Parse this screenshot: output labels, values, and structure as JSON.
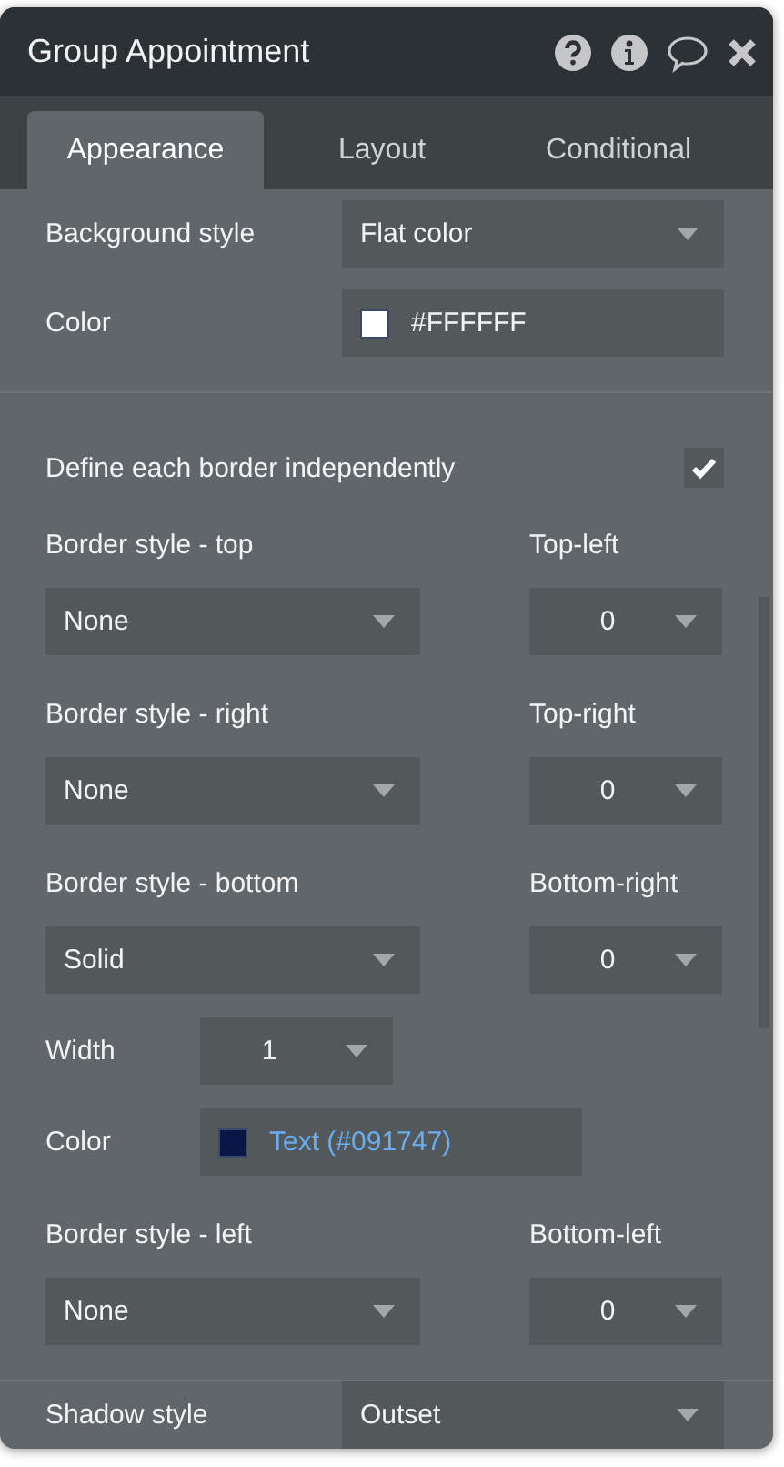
{
  "title": "Group Appointment",
  "tabs": [
    {
      "label": "Appearance",
      "selected": true
    },
    {
      "label": "Layout",
      "selected": false
    },
    {
      "label": "Conditional",
      "selected": false
    }
  ],
  "background": [
    {
      "kind": "select",
      "label": "Background style",
      "value": "Flat color"
    },
    {
      "kind": "color",
      "label": "Color",
      "color": "#ffffff",
      "value": "#FFFFFF",
      "style_ref": false
    }
  ],
  "borders": {
    "independent": {
      "label": "Define each border independently",
      "checked": true
    },
    "sides": [
      {
        "label": "Border style - top",
        "value": "None",
        "corner_label": "Top-left",
        "corner_value": "0"
      },
      {
        "label": "Border style - right",
        "value": "None",
        "corner_label": "Top-right",
        "corner_value": "0"
      },
      {
        "label": "Border style - bottom",
        "value": "Solid",
        "corner_label": "Bottom-right",
        "corner_value": "0",
        "extras": [
          {
            "kind": "select",
            "label": "Width",
            "value": "1"
          },
          {
            "kind": "color",
            "label": "Color",
            "color": "#091747",
            "value": "Text (#091747)",
            "style_ref": true
          }
        ]
      },
      {
        "label": "Border style - left",
        "value": "None",
        "corner_label": "Bottom-left",
        "corner_value": "0"
      }
    ]
  },
  "shadow": [
    {
      "kind": "select",
      "label": "Shadow style",
      "value": "Outset"
    }
  ]
}
